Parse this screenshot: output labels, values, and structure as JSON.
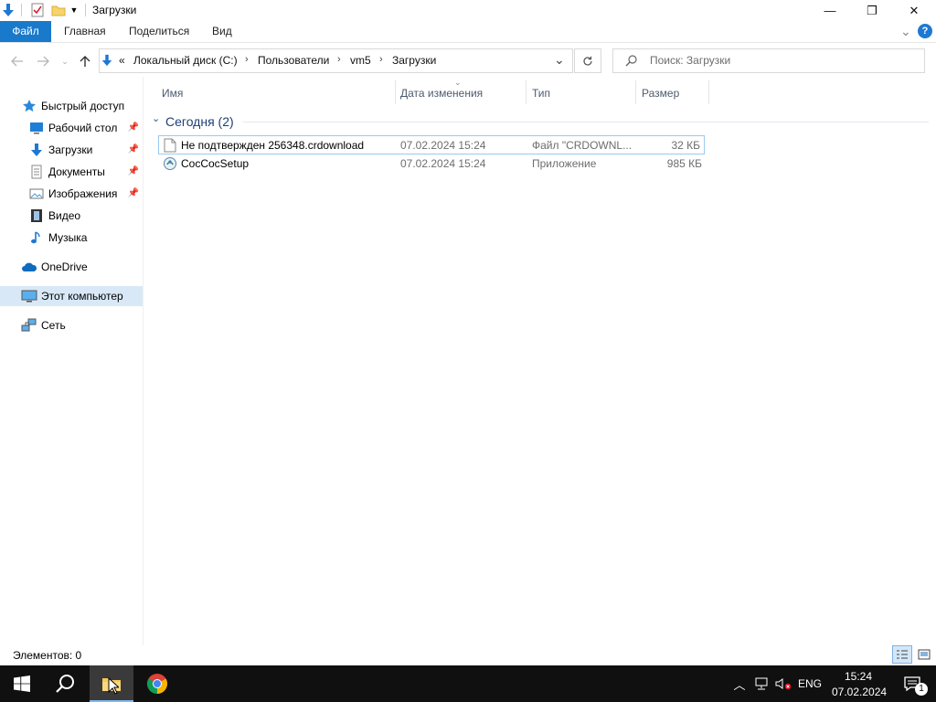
{
  "window": {
    "title": "Загрузки",
    "minimize_glyph": "—",
    "restore_glyph": "❐",
    "close_glyph": "✕"
  },
  "ribbon": {
    "tabs": [
      "Файл",
      "Главная",
      "Поделиться",
      "Вид"
    ],
    "collapse_glyph": "⌄",
    "help_glyph": "?"
  },
  "address": {
    "overflow": "«",
    "breadcrumbs": [
      "Локальный диск (C:)",
      "Пользователи",
      "vm5",
      "Загрузки"
    ],
    "search_placeholder": "Поиск: Загрузки"
  },
  "sidebar": {
    "items": [
      {
        "label": "Быстрый доступ",
        "icon": "star-icon",
        "pinned": false
      },
      {
        "label": "Рабочий стол",
        "icon": "desktop-icon",
        "pinned": true
      },
      {
        "label": "Загрузки",
        "icon": "download-icon",
        "pinned": true
      },
      {
        "label": "Документы",
        "icon": "documents-icon",
        "pinned": true
      },
      {
        "label": "Изображения",
        "icon": "pictures-icon",
        "pinned": true
      },
      {
        "label": "Видео",
        "icon": "video-icon",
        "pinned": false
      },
      {
        "label": "Музыка",
        "icon": "music-icon",
        "pinned": false
      },
      {
        "label": "OneDrive",
        "icon": "cloud-icon",
        "pinned": false
      },
      {
        "label": "Этот компьютер",
        "icon": "computer-icon",
        "pinned": false,
        "selected": true
      },
      {
        "label": "Сеть",
        "icon": "network-icon",
        "pinned": false
      }
    ]
  },
  "columns": [
    "Имя",
    "Дата изменения",
    "Тип",
    "Размер"
  ],
  "group": {
    "label": "Сегодня (2)"
  },
  "files": [
    {
      "name": "Не подтвержден 256348.crdownload",
      "date": "07.02.2024 15:24",
      "type": "Файл \"CRDOWNL...",
      "size": "32 КБ",
      "icon": "file-icon"
    },
    {
      "name": "CocCocSetup",
      "date": "07.02.2024 15:24",
      "type": "Приложение",
      "size": "985 КБ",
      "icon": "installer-icon"
    }
  ],
  "status": {
    "items_count": "Элементов: 0"
  },
  "taskbar": {
    "lang": "ENG",
    "time": "15:24",
    "date": "07.02.2024",
    "notifications": "1"
  },
  "colors": {
    "accent": "#1979ca",
    "taskbar": "#101010",
    "selected_nav": "#cce8ff"
  }
}
